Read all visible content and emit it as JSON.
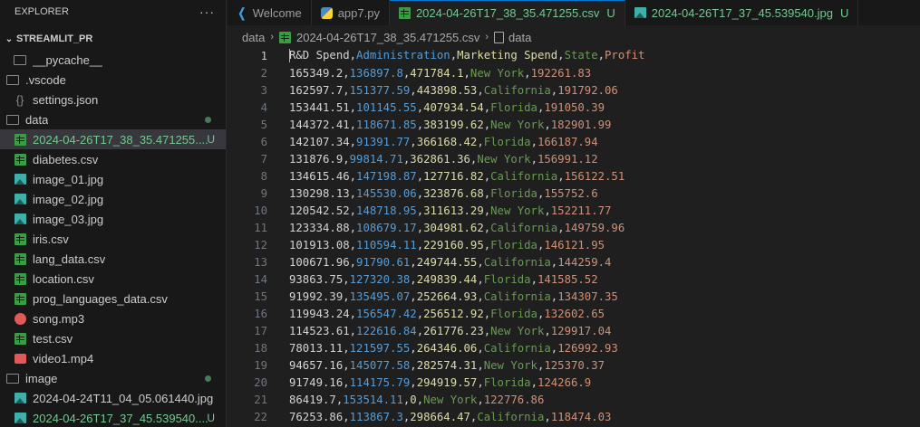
{
  "sidebar": {
    "header": "EXPLORER",
    "more": "···",
    "section": "STREAMLIT_PR",
    "tree": [
      {
        "label": "__pycache__",
        "icon": "folder-icon",
        "depth": 1,
        "chevron": "›",
        "status": ""
      },
      {
        "label": ".vscode",
        "icon": "folder-icon",
        "depth": 0,
        "chevron": "⌄",
        "status": ""
      },
      {
        "label": "settings.json",
        "icon": "gear-icon",
        "depth": 1,
        "chevron": "",
        "status": ""
      },
      {
        "label": "data",
        "icon": "folder-icon",
        "depth": 0,
        "chevron": "⌄",
        "status": "dot"
      },
      {
        "label": "2024-04-26T17_38_35.471255....",
        "icon": "csv-icon",
        "depth": 1,
        "chevron": "",
        "status": "U",
        "selected": true,
        "green": true
      },
      {
        "label": "diabetes.csv",
        "icon": "csv-icon",
        "depth": 1,
        "chevron": "",
        "status": ""
      },
      {
        "label": "image_01.jpg",
        "icon": "image-icon",
        "depth": 1,
        "chevron": "",
        "status": ""
      },
      {
        "label": "image_02.jpg",
        "icon": "image-icon",
        "depth": 1,
        "chevron": "",
        "status": ""
      },
      {
        "label": "image_03.jpg",
        "icon": "image-icon",
        "depth": 1,
        "chevron": "",
        "status": ""
      },
      {
        "label": "iris.csv",
        "icon": "csv-icon",
        "depth": 1,
        "chevron": "",
        "status": ""
      },
      {
        "label": "lang_data.csv",
        "icon": "csv-icon",
        "depth": 1,
        "chevron": "",
        "status": ""
      },
      {
        "label": "location.csv",
        "icon": "csv-icon",
        "depth": 1,
        "chevron": "",
        "status": ""
      },
      {
        "label": "prog_languages_data.csv",
        "icon": "csv-icon",
        "depth": 1,
        "chevron": "",
        "status": ""
      },
      {
        "label": "song.mp3",
        "icon": "audio-icon",
        "depth": 1,
        "chevron": "",
        "status": ""
      },
      {
        "label": "test.csv",
        "icon": "csv-icon",
        "depth": 1,
        "chevron": "",
        "status": ""
      },
      {
        "label": "video1.mp4",
        "icon": "video-icon",
        "depth": 1,
        "chevron": "",
        "status": ""
      },
      {
        "label": "image",
        "icon": "folder-icon",
        "depth": 0,
        "chevron": "⌄",
        "status": "dot"
      },
      {
        "label": "2024-04-24T11_04_05.061440.jpg",
        "icon": "image-icon",
        "depth": 1,
        "chevron": "",
        "status": ""
      },
      {
        "label": "2024-04-26T17_37_45.539540....",
        "icon": "image-icon",
        "depth": 1,
        "chevron": "",
        "status": "U",
        "green": true
      }
    ]
  },
  "tabs": [
    {
      "label": "Welcome",
      "icon": "vscode-icon"
    },
    {
      "label": "app7.py",
      "icon": "python-icon"
    },
    {
      "label": "2024-04-26T17_38_35.471255.csv",
      "icon": "csv-icon",
      "status": "U",
      "active": true
    },
    {
      "label": "2024-04-26T17_37_45.539540.jpg",
      "icon": "image-icon",
      "status": "U"
    }
  ],
  "breadcrumb": {
    "folder": "data",
    "file": "2024-04-26T17_38_35.471255.csv",
    "symbol": "data"
  },
  "colors": {
    "col1": "#d4d4d4",
    "col2": "#569cd6",
    "col3": "#dcdcaa",
    "col4": "#6a9955",
    "col5": "#ce9178",
    "untracked": "#73c991"
  },
  "editor": {
    "lines": [
      [
        "R&D Spend",
        "Administration",
        "Marketing Spend",
        "State",
        "Profit"
      ],
      [
        "165349.2",
        "136897.8",
        "471784.1",
        "New York",
        "192261.83"
      ],
      [
        "162597.7",
        "151377.59",
        "443898.53",
        "California",
        "191792.06"
      ],
      [
        "153441.51",
        "101145.55",
        "407934.54",
        "Florida",
        "191050.39"
      ],
      [
        "144372.41",
        "118671.85",
        "383199.62",
        "New York",
        "182901.99"
      ],
      [
        "142107.34",
        "91391.77",
        "366168.42",
        "Florida",
        "166187.94"
      ],
      [
        "131876.9",
        "99814.71",
        "362861.36",
        "New York",
        "156991.12"
      ],
      [
        "134615.46",
        "147198.87",
        "127716.82",
        "California",
        "156122.51"
      ],
      [
        "130298.13",
        "145530.06",
        "323876.68",
        "Florida",
        "155752.6"
      ],
      [
        "120542.52",
        "148718.95",
        "311613.29",
        "New York",
        "152211.77"
      ],
      [
        "123334.88",
        "108679.17",
        "304981.62",
        "California",
        "149759.96"
      ],
      [
        "101913.08",
        "110594.11",
        "229160.95",
        "Florida",
        "146121.95"
      ],
      [
        "100671.96",
        "91790.61",
        "249744.55",
        "California",
        "144259.4"
      ],
      [
        "93863.75",
        "127320.38",
        "249839.44",
        "Florida",
        "141585.52"
      ],
      [
        "91992.39",
        "135495.07",
        "252664.93",
        "California",
        "134307.35"
      ],
      [
        "119943.24",
        "156547.42",
        "256512.92",
        "Florida",
        "132602.65"
      ],
      [
        "114523.61",
        "122616.84",
        "261776.23",
        "New York",
        "129917.04"
      ],
      [
        "78013.11",
        "121597.55",
        "264346.06",
        "California",
        "126992.93"
      ],
      [
        "94657.16",
        "145077.58",
        "282574.31",
        "New York",
        "125370.37"
      ],
      [
        "91749.16",
        "114175.79",
        "294919.57",
        "Florida",
        "124266.9"
      ],
      [
        "86419.7",
        "153514.11",
        "0",
        "New York",
        "122776.86"
      ],
      [
        "76253.86",
        "113867.3",
        "298664.47",
        "California",
        "118474.03"
      ]
    ]
  }
}
